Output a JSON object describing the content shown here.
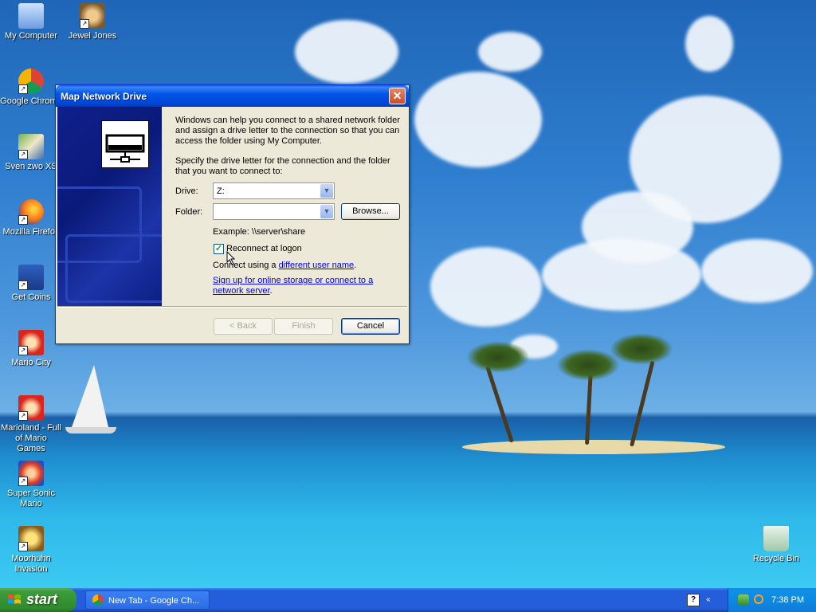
{
  "desktop": {
    "icons": [
      {
        "label": "My Computer"
      },
      {
        "label": "Jewel Jones"
      },
      {
        "label": "Google Chrome"
      },
      {
        "label": "Sven zwo XS"
      },
      {
        "label": "Mozilla Firefox"
      },
      {
        "label": "Get Coins"
      },
      {
        "label": "Mario City"
      },
      {
        "label": "Marioland - Full of Mario Games"
      },
      {
        "label": "Super Sonic Mario"
      },
      {
        "label": "Moorhuhn Invasion"
      },
      {
        "label": "Recycle Bin"
      }
    ]
  },
  "dialog": {
    "title": "Map Network Drive",
    "close_glyph": "✕",
    "intro": "Windows can help you connect to a shared network folder and assign a drive letter to the connection so that you can access the folder using My Computer.",
    "instructions": "Specify the drive letter for the connection and the folder that you want to connect to:",
    "drive_label": "Drive:",
    "drive_value": "Z:",
    "folder_label": "Folder:",
    "folder_value": "",
    "browse_label": "Browse...",
    "example": "Example: \\\\server\\share",
    "reconnect_label": "Reconnect at logon",
    "reconnect_checked": true,
    "connect_prefix": "Connect using a ",
    "connect_link": "different user name",
    "connect_suffix": ".",
    "signup_link": "Sign up for online storage or connect to a network server",
    "signup_suffix": ".",
    "back_label": "< Back",
    "finish_label": "Finish",
    "cancel_label": "Cancel"
  },
  "taskbar": {
    "start_label": "start",
    "task_item": "New Tab - Google Ch...",
    "clock": "7:38 PM"
  },
  "colors": {
    "titlebar": "#0055ea",
    "dialog_bg": "#ece9d8",
    "link": "#0000ee",
    "taskbar": "#245edb",
    "start_button": "#3c9c3a"
  }
}
